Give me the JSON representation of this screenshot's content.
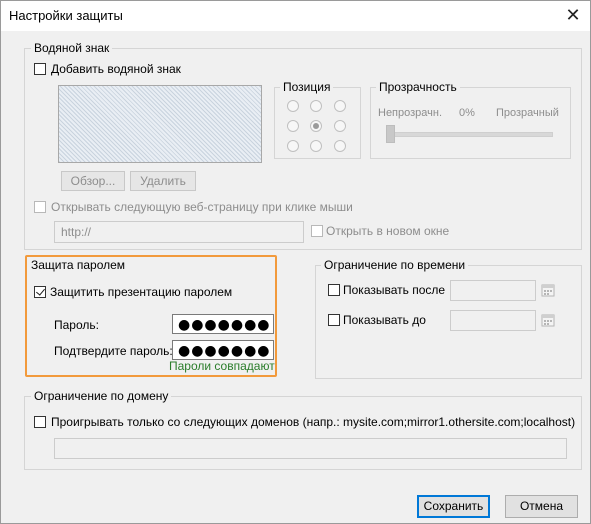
{
  "window": {
    "title": "Настройки защиты"
  },
  "watermark": {
    "legend": "Водяной знак",
    "add_label": "Добавить водяной знак",
    "position_legend": "Позиция",
    "transparency_legend": "Прозрачность",
    "opaque_label": "Непрозрачн.",
    "transparency_value": "0%",
    "transparent_label": "Прозрачный",
    "transparency_level": 0,
    "browse_button": "Обзор...",
    "delete_button": "Удалить",
    "open_url_label": "Открывать следующую веб-страницу при клике мыши",
    "url_value": "http://",
    "new_window_label": "Открыть в новом окне",
    "selected_position": "center"
  },
  "password": {
    "legend": "Защита паролем",
    "protect_label": "Защитить презентацию паролем",
    "protect_checked": true,
    "password_label": "Пароль:",
    "password_value": "●●●●●●●",
    "confirm_label": "Подтвердите пароль:",
    "confirm_value": "●●●●●●●",
    "match_status": "Пароли совпадают",
    "highlight_color": "#f29a3c",
    "status_color": "#2a7d2a"
  },
  "time_limit": {
    "legend": "Ограничение по времени",
    "show_after_label": "Показывать после",
    "show_until_label": "Показывать до"
  },
  "domain": {
    "legend": "Ограничение по домену",
    "play_only_label": "Проигрывать только со следующих доменов (напр.: mysite.com;mirror1.othersite.com;localhost)",
    "domains_value": ""
  },
  "buttons": {
    "save": "Сохранить",
    "cancel": "Отмена"
  },
  "colors": {
    "accent": "#0078d7"
  }
}
